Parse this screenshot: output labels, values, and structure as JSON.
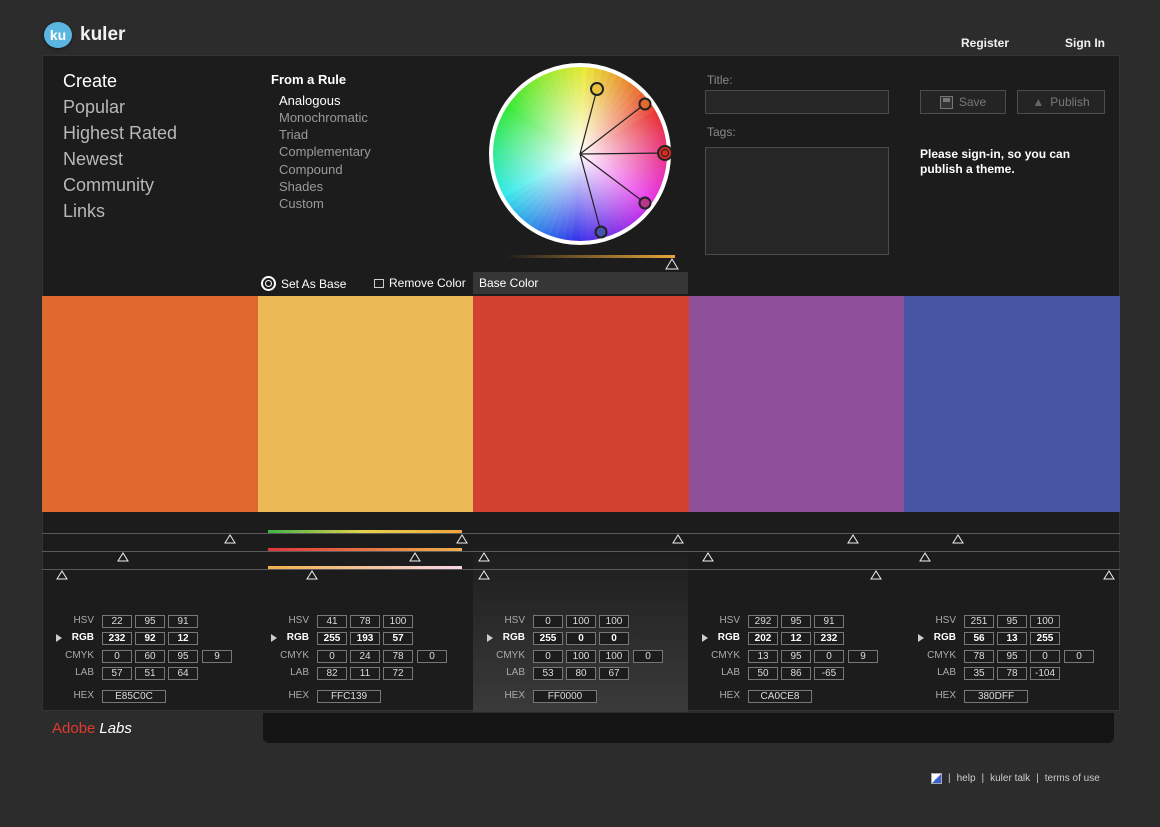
{
  "app": {
    "logo_badge": "ku",
    "title": "kuler"
  },
  "header": {
    "register": "Register",
    "sign_in": "Sign In"
  },
  "nav": [
    {
      "label": "Create",
      "active": true
    },
    {
      "label": "Popular"
    },
    {
      "label": "Highest Rated"
    },
    {
      "label": "Newest"
    },
    {
      "label": "Community"
    },
    {
      "label": "Links"
    }
  ],
  "rules": {
    "heading": "From a Rule",
    "items": [
      {
        "label": "Analogous",
        "active": true
      },
      {
        "label": "Monochromatic"
      },
      {
        "label": "Triad"
      },
      {
        "label": "Complementary"
      },
      {
        "label": "Compound"
      },
      {
        "label": "Shades"
      },
      {
        "label": "Custom"
      }
    ]
  },
  "form": {
    "title_label": "Title:",
    "tags_label": "Tags:",
    "save": "Save",
    "publish": "Publish",
    "note": "Please sign-in, so you can publish a theme."
  },
  "toolbar": {
    "set_as_base": "Set As Base",
    "remove_color": "Remove Color",
    "base_color": "Base Color"
  },
  "colors": [
    {
      "swatch": "#E0692F",
      "hsv": [
        "22",
        "95",
        "91"
      ],
      "rgb": [
        "232",
        "92",
        "12"
      ],
      "cmyk": [
        "0",
        "60",
        "95",
        "9"
      ],
      "lab": [
        "57",
        "51",
        "64"
      ],
      "hex": "E85C0C"
    },
    {
      "swatch": "#EBB955",
      "hsv": [
        "41",
        "78",
        "100"
      ],
      "rgb": [
        "255",
        "193",
        "57"
      ],
      "cmyk": [
        "0",
        "24",
        "78",
        "0"
      ],
      "lab": [
        "82",
        "11",
        "72"
      ],
      "hex": "FFC139"
    },
    {
      "swatch": "#D24130",
      "hsv": [
        "0",
        "100",
        "100"
      ],
      "rgb": [
        "255",
        "0",
        "0"
      ],
      "cmyk": [
        "0",
        "100",
        "100",
        "0"
      ],
      "lab": [
        "53",
        "80",
        "67"
      ],
      "hex": "FF0000",
      "base": true
    },
    {
      "swatch": "#8E4F9B",
      "hsv": [
        "292",
        "95",
        "91"
      ],
      "rgb": [
        "202",
        "12",
        "232"
      ],
      "cmyk": [
        "13",
        "95",
        "0",
        "9"
      ],
      "lab": [
        "50",
        "86",
        "-65"
      ],
      "hex": "CA0CE8"
    },
    {
      "swatch": "#4854A4",
      "hsv": [
        "251",
        "95",
        "100"
      ],
      "rgb": [
        "56",
        "13",
        "255"
      ],
      "cmyk": [
        "78",
        "95",
        "0",
        "0"
      ],
      "lab": [
        "35",
        "78",
        "-104"
      ],
      "hex": "380DFF"
    }
  ],
  "labels": {
    "hsv": "HSV",
    "rgb": "RGB",
    "cmyk": "CMYK",
    "lab": "LAB",
    "hex": "HEX"
  },
  "footer": {
    "adobe": "Adobe",
    "labs": "Labs",
    "help": "help",
    "kuler_talk": "kuler talk",
    "terms": "terms of use",
    "sep": "|"
  }
}
